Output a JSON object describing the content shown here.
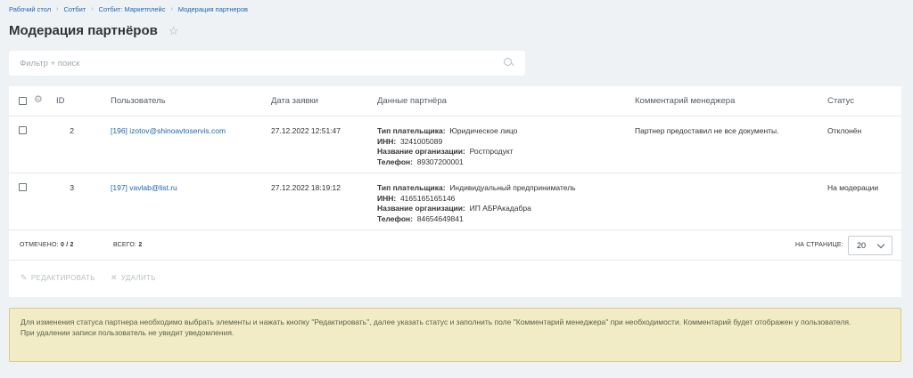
{
  "breadcrumbs": [
    "Рабочий стол",
    "Сотбит",
    "Сотбит: Маркетплейс",
    "Модерация партнеров"
  ],
  "page_title": "Модерация партнёров",
  "filter": {
    "placeholder": "Фильтр + поиск",
    "value": ""
  },
  "columns": [
    "ID",
    "Пользователь",
    "Дата заявки",
    "Данные партнёра",
    "Комментарий менеджера",
    "Статус"
  ],
  "rows": [
    {
      "id": "2",
      "user": "[196] izotov@shinoavtoservis.com",
      "date": "27.12.2022 12:51:47",
      "partner": [
        {
          "label": "Тип плательщика:",
          "value": "Юридическое лицо"
        },
        {
          "label": "ИНН:",
          "value": "3241005089"
        },
        {
          "label": "Название организации:",
          "value": "Ростпродукт"
        },
        {
          "label": "Телефон:",
          "value": "89307200001"
        }
      ],
      "comment": "Партнер предоставил не все документы.",
      "status": "Отклонён"
    },
    {
      "id": "3",
      "user": "[197] vavlab@list.ru",
      "date": "27.12.2022 18:19:12",
      "partner": [
        {
          "label": "Тип плательщика:",
          "value": "Индивидуальный предприниматель"
        },
        {
          "label": "ИНН:",
          "value": "4165165165146"
        },
        {
          "label": "Название организации:",
          "value": "ИП АБРАкадабра"
        },
        {
          "label": "Телефон:",
          "value": "84654649841"
        }
      ],
      "comment": "",
      "status": "На модерации"
    }
  ],
  "footer": {
    "selected_label": "ОТМЕЧЕНО:",
    "selected_value": "0 / 2",
    "total_label": "ВСЕГО:",
    "total_value": "2",
    "per_page_label": "НА СТРАНИЦЕ:",
    "per_page_value": "20"
  },
  "actions": {
    "edit": "РЕДАКТИРОВАТЬ",
    "delete": "УДАЛИТЬ"
  },
  "notice": {
    "line1": "Для изменения статуса партнера необходимо выбрать элементы и нажать кнопку \"Редактировать\", далее указать статус и заполнить поле \"Комментарий менеджера\" при необходимости. Комментарий будет отображен у пользователя.",
    "line2": "При удалении записи пользователь не увидит уведомления."
  },
  "icons": [
    "star-icon",
    "search-icon",
    "gear-icon",
    "chevron-down-icon",
    "pencil-icon",
    "close-icon"
  ],
  "colors": {
    "link": "#2067b0",
    "notice_bg": "#f1ecc5",
    "page_bg": "#eef2f4"
  }
}
